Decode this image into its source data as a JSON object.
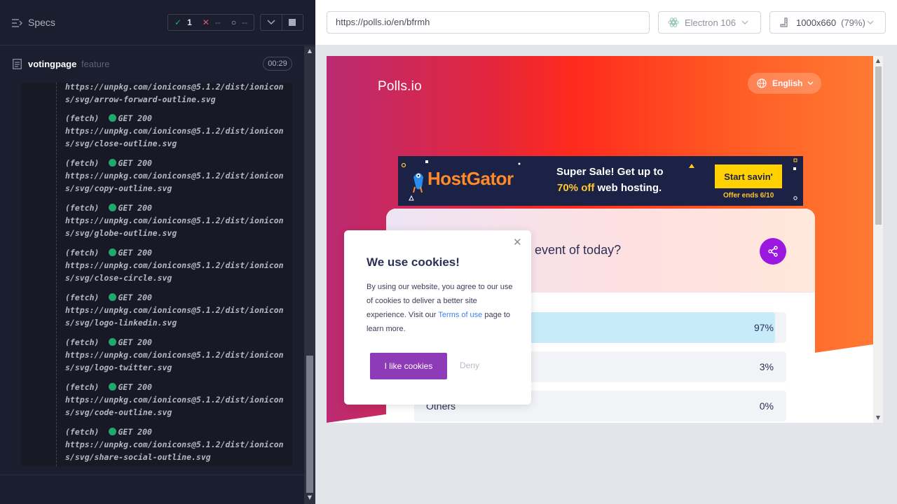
{
  "runner": {
    "specs_label": "Specs",
    "stats": {
      "passed": "1",
      "failed": "--",
      "pending": "--"
    },
    "spec": {
      "name": "votingpage",
      "tag": "feature",
      "duration": "00:29"
    },
    "log_first_continuation": {
      "line1": "https://unpkg.com/ionicons@5.1.2/dist/ionicon",
      "line2": "s/svg/arrow-forward-outline.svg"
    },
    "logs": [
      {
        "prefix": "(fetch)",
        "status": "GET 200",
        "line1": "https://unpkg.com/ionicons@5.1.2/dist/ionicon",
        "line2": "s/svg/close-outline.svg"
      },
      {
        "prefix": "(fetch)",
        "status": "GET 200",
        "line1": "https://unpkg.com/ionicons@5.1.2/dist/ionicon",
        "line2": "s/svg/copy-outline.svg"
      },
      {
        "prefix": "(fetch)",
        "status": "GET 200",
        "line1": "https://unpkg.com/ionicons@5.1.2/dist/ionicon",
        "line2": "s/svg/globe-outline.svg"
      },
      {
        "prefix": "(fetch)",
        "status": "GET 200",
        "line1": "https://unpkg.com/ionicons@5.1.2/dist/ionicon",
        "line2": "s/svg/close-circle.svg"
      },
      {
        "prefix": "(fetch)",
        "status": "GET 200",
        "line1": "https://unpkg.com/ionicons@5.1.2/dist/ionicon",
        "line2": "s/svg/logo-linkedin.svg"
      },
      {
        "prefix": "(fetch)",
        "status": "GET 200",
        "line1": "https://unpkg.com/ionicons@5.1.2/dist/ionicon",
        "line2": "s/svg/logo-twitter.svg"
      },
      {
        "prefix": "(fetch)",
        "status": "GET 200",
        "line1": "https://unpkg.com/ionicons@5.1.2/dist/ionicon",
        "line2": "s/svg/code-outline.svg"
      },
      {
        "prefix": "(fetch)",
        "status": "GET 200",
        "line1": "https://unpkg.com/ionicons@5.1.2/dist/ionicon",
        "line2": "s/svg/share-social-outline.svg"
      }
    ]
  },
  "aut": {
    "url": "https://polls.io/en/bfrmh",
    "browser": "Electron 106",
    "viewport": "1000x660",
    "zoom": "(79%)"
  },
  "app": {
    "brand": "Polls.io",
    "language": "English",
    "ad": {
      "logo": "HostGator",
      "line1": "Super Sale! Get up to",
      "line2_highlight": "70% off",
      "line2_rest": " web hosting.",
      "cta": "Start savin'",
      "ends": "Offer ends 6/10"
    },
    "poll": {
      "question_visible": "ite event of today?",
      "options": [
        {
          "label": "",
          "percent": "97%",
          "value": 0.97
        },
        {
          "label": "",
          "percent": "3%",
          "value": 0.03
        },
        {
          "label": "Others",
          "percent": "0%",
          "value": 0.0
        }
      ]
    },
    "cookie": {
      "title": "We use cookies!",
      "body_before": "By using our website, you agree to our use of cookies to deliver a better site experience. Visit our ",
      "link": "Terms of use",
      "body_after": " page to learn more.",
      "accept": "I like cookies",
      "deny": "Deny"
    }
  },
  "colors": {
    "runner_bg": "#1b1e2e",
    "pass_green": "#1fa971",
    "fail_red": "#e45770",
    "cookie_accept": "#8e3bb8",
    "share_button": "#9b18e0",
    "bar_fill": "#c8ebfa"
  }
}
